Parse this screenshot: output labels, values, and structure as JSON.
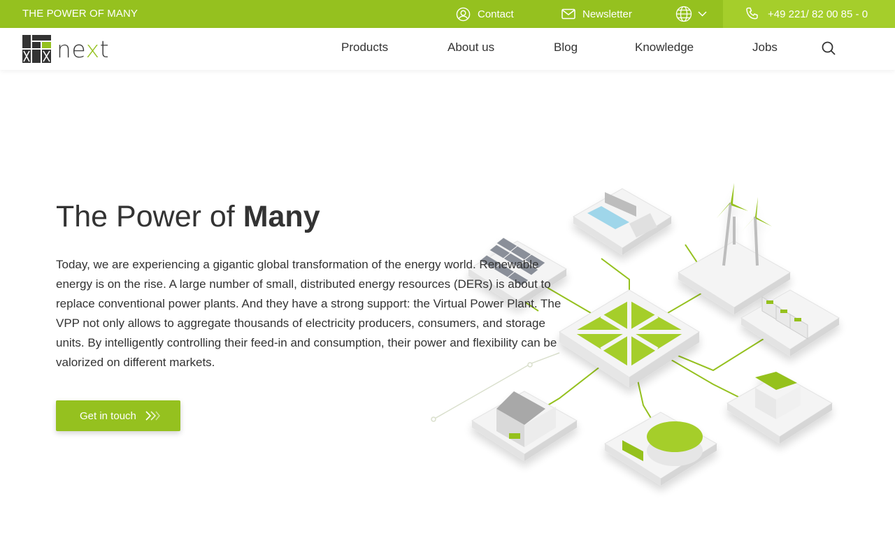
{
  "topbar": {
    "tagline": "THE POWER OF MANY",
    "contact_label": "Contact",
    "newsletter_label": "Newsletter",
    "phone": "+49 221/ 82 00 85 - 0"
  },
  "header": {
    "logo_text": "next",
    "nav": [
      "Products",
      "About us",
      "Blog",
      "Knowledge",
      "Jobs"
    ]
  },
  "hero": {
    "title_light": "The Power of ",
    "title_bold": "Many",
    "text": "Today, we are experiencing a gigantic global transformation of the energy world. Renewable energy is on the rise. A large number of small, distributed energy resources (DERs) is about to replace conventional power plants. And they have a strong support: the Virtual Power Plant. The VPP not only allows to aggregate thousands of electricity producers, consumers, and storage units. By intelligently controlling their feed-in and consumption, their power and flexibility can be valorized on different markets.",
    "cta_label": "Get in touch"
  },
  "colors": {
    "brand_green": "#95c11f",
    "brand_green_light": "#a5ce2b",
    "text": "#333333"
  },
  "icons": [
    "user-icon",
    "mail-icon",
    "globe-icon",
    "chevron-down-icon",
    "phone-icon",
    "search-icon",
    "double-chevron-right-icon"
  ]
}
